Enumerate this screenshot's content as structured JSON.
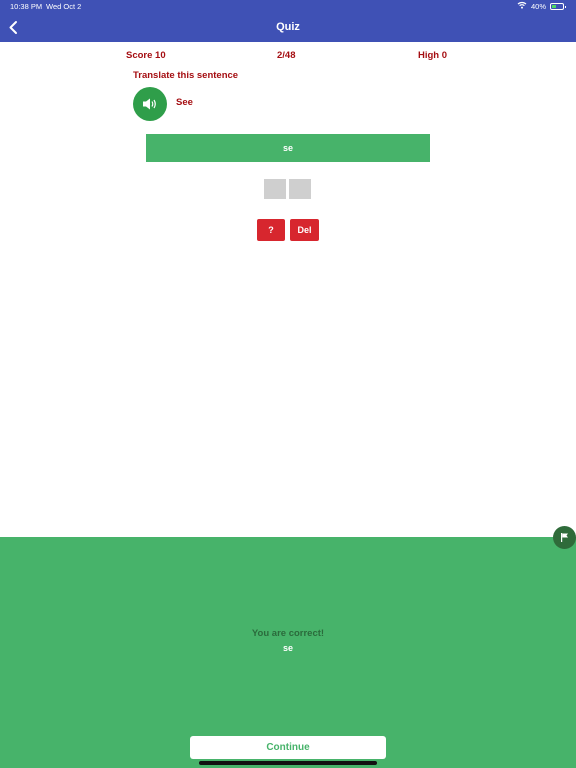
{
  "status_bar": {
    "time": "10:38 PM",
    "date": "Wed Oct 2",
    "battery_text": "40%",
    "battery_level": 0.4,
    "icons": [
      "wifi-icon",
      "battery-icon"
    ]
  },
  "nav": {
    "title": "Quiz",
    "back_icon": "chevron-left-icon"
  },
  "quiz": {
    "score": "Score  10",
    "progress": "2/48",
    "high": "High  0",
    "prompt": "Translate this sentence",
    "word": "See",
    "speaker_icon": "speaker-icon",
    "answer": "se",
    "hint_label": "?",
    "delete_label": "Del"
  },
  "result": {
    "title": "You are correct!",
    "answer": "se",
    "continue_label": "Continue",
    "flag_icon": "flag-icon"
  },
  "colors": {
    "nav": "#3f51b5",
    "text_dark_red": "#a50e12",
    "green": "#47b36a",
    "green_dark": "#2f9e4a",
    "red": "#d7262e",
    "slot_gray": "#cfcfcf",
    "flag_green": "#2f6b3a",
    "result_title_green": "#2b6b3c"
  }
}
